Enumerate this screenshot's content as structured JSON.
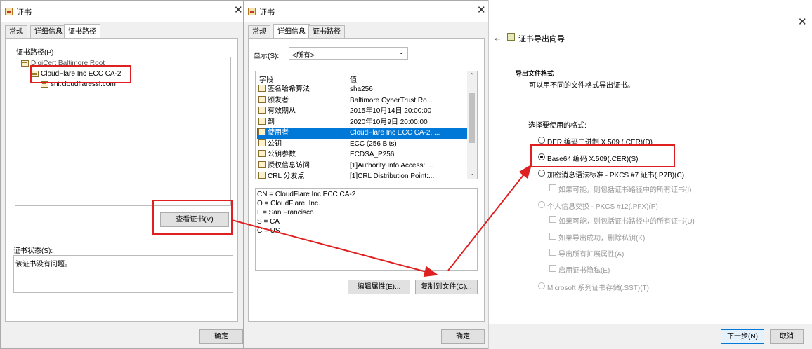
{
  "win1": {
    "title": "证书",
    "tabs": [
      "常规",
      "详细信息",
      "证书路径"
    ],
    "path_label": "证书路径(P)",
    "tree": [
      "DigiCert Baltimore Root",
      "CloudFlare Inc ECC CA-2",
      "sni.cloudflaressl.com"
    ],
    "view_cert_button": "查看证书(V)",
    "status_label": "证书状态(S):",
    "status_text": "该证书没有问题。",
    "ok_button": "确定"
  },
  "win2": {
    "title": "证书",
    "tabs": [
      "常规",
      "详细信息",
      "证书路径"
    ],
    "show_label": "显示(S):",
    "show_value": "<所有>",
    "col_field": "字段",
    "col_value": "值",
    "rows": [
      {
        "field": "签名哈希算法",
        "value": "sha256"
      },
      {
        "field": "颁发者",
        "value": "Baltimore CyberTrust Ro..."
      },
      {
        "field": "有效期从",
        "value": "2015年10月14日 20:00:00"
      },
      {
        "field": "到",
        "value": "2020年10月9日 20:00:00"
      },
      {
        "field": "使用者",
        "value": "CloudFlare Inc ECC CA-2, ..."
      },
      {
        "field": "公钥",
        "value": "ECC (256 Bits)"
      },
      {
        "field": "公钥参数",
        "value": "ECDSA_P256"
      },
      {
        "field": "授权信息访问",
        "value": "[1]Authority Info Access: ..."
      },
      {
        "field": "CRL 分发点",
        "value": "[1]CRL Distribution Point:..."
      }
    ],
    "detail_lines": [
      "CN = CloudFlare Inc ECC CA-2",
      "O = CloudFlare, Inc.",
      "L = San Francisco",
      "S = CA",
      "C = US"
    ],
    "edit_props_button": "编辑属性(E)...",
    "copy_to_file_button": "复制到文件(C)...",
    "ok_button": "确定"
  },
  "wizard": {
    "title": "证书导出向导",
    "heading": "导出文件格式",
    "subheading": "可以用不同的文件格式导出证书。",
    "choose_label": "选择要使用的格式:",
    "opt_der": "DER 编码二进制 X.509 (.CER)(D)",
    "opt_base64": "Base64 编码 X.509(.CER)(S)",
    "opt_pkcs7": "加密消息语法标准 - PKCS #7 证书(.P7B)(C)",
    "chk_pkcs7_include": "如果可能，则包括证书路径中的所有证书(I)",
    "opt_pfx": "个人信息交换 - PKCS #12(.PFX)(P)",
    "chk_pfx_include": "如果可能，则包括证书路径中的所有证书(U)",
    "chk_delete_key": "如果导出成功，删除私钥(K)",
    "chk_export_ext": "导出所有扩展属性(A)",
    "chk_privacy": "启用证书隐私(E)",
    "opt_sst": "Microsoft 系列证书存储(.SST)(T)",
    "next_button": "下一步(N)",
    "cancel_button": "取消"
  },
  "colors": {
    "annotation": "#e02020",
    "selection": "#0078d7"
  }
}
